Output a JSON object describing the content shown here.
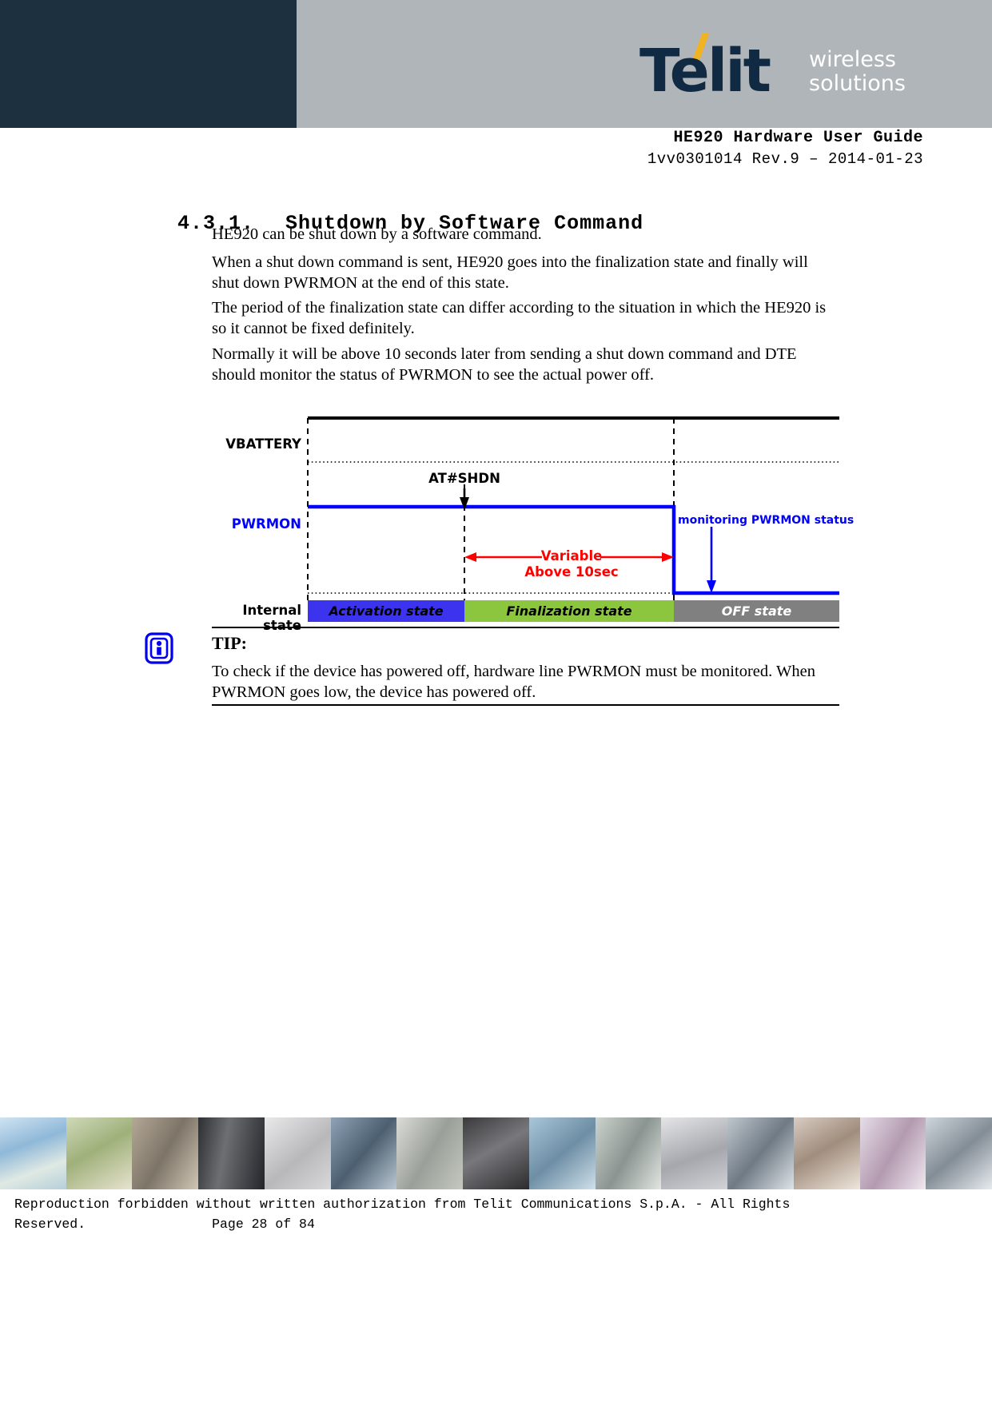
{
  "header": {
    "logo": {
      "wordmark": "Telit",
      "tagline_line1": "wireless",
      "tagline_line2": "solutions",
      "accent_color": "#f0b323",
      "dark_color": "#102a43",
      "band_dark": "#1d3040",
      "band_gray": "#b0b5b9"
    },
    "doc_title": "HE920 Hardware User Guide",
    "doc_subtitle": "1vv0301014 Rev.9 – 2014-01-23"
  },
  "section": {
    "number": "4.3.1.",
    "title": "Shutdown by Software Command"
  },
  "paragraphs": {
    "p1": "HE920 can be shut down by a software command.",
    "p2": "When a shut down command is sent, HE920 goes into the finalization state and finally will shut down PWRMON at the end of this state.",
    "p3": "The period of the finalization state can differ according to the situation in which the HE920 is so it cannot be fixed definitely.",
    "p4": "Normally it will be above 10 seconds later from sending a shut down command and DTE should monitor the status of PWRMON to see the actual power off."
  },
  "diagram": {
    "labels": {
      "vbattery": "VBATTERY",
      "pwrmon": "PWRMON",
      "internal_state": "Internal state",
      "command": "AT#SHDN",
      "monitoring": "monitoring PWRMON status",
      "variable_line1": "Variable",
      "variable_line2": "Above 10sec"
    },
    "states": [
      {
        "name": "Activation  state",
        "color": "#3b33ee"
      },
      {
        "name": "Finalization state",
        "color": "#8cc63f"
      },
      {
        "name": "OFF state",
        "color": "#808080"
      }
    ],
    "colors": {
      "vbattery_line": "#000000",
      "pwrmon_line": "#0000ff",
      "annotation_red": "#ff0000",
      "dashed": "#000000"
    }
  },
  "tip": {
    "icon": "info-icon",
    "label": "TIP:",
    "text": "To check if the device has powered off, hardware line PWRMON must be monitored. When PWRMON goes low, the device has powered off."
  },
  "footer": {
    "line1": "Reproduction forbidden without written authorization from Telit Communications S.p.A. - All Rights",
    "line2_prefix": "Reserved.",
    "page_label": "Page 28 of 84"
  }
}
